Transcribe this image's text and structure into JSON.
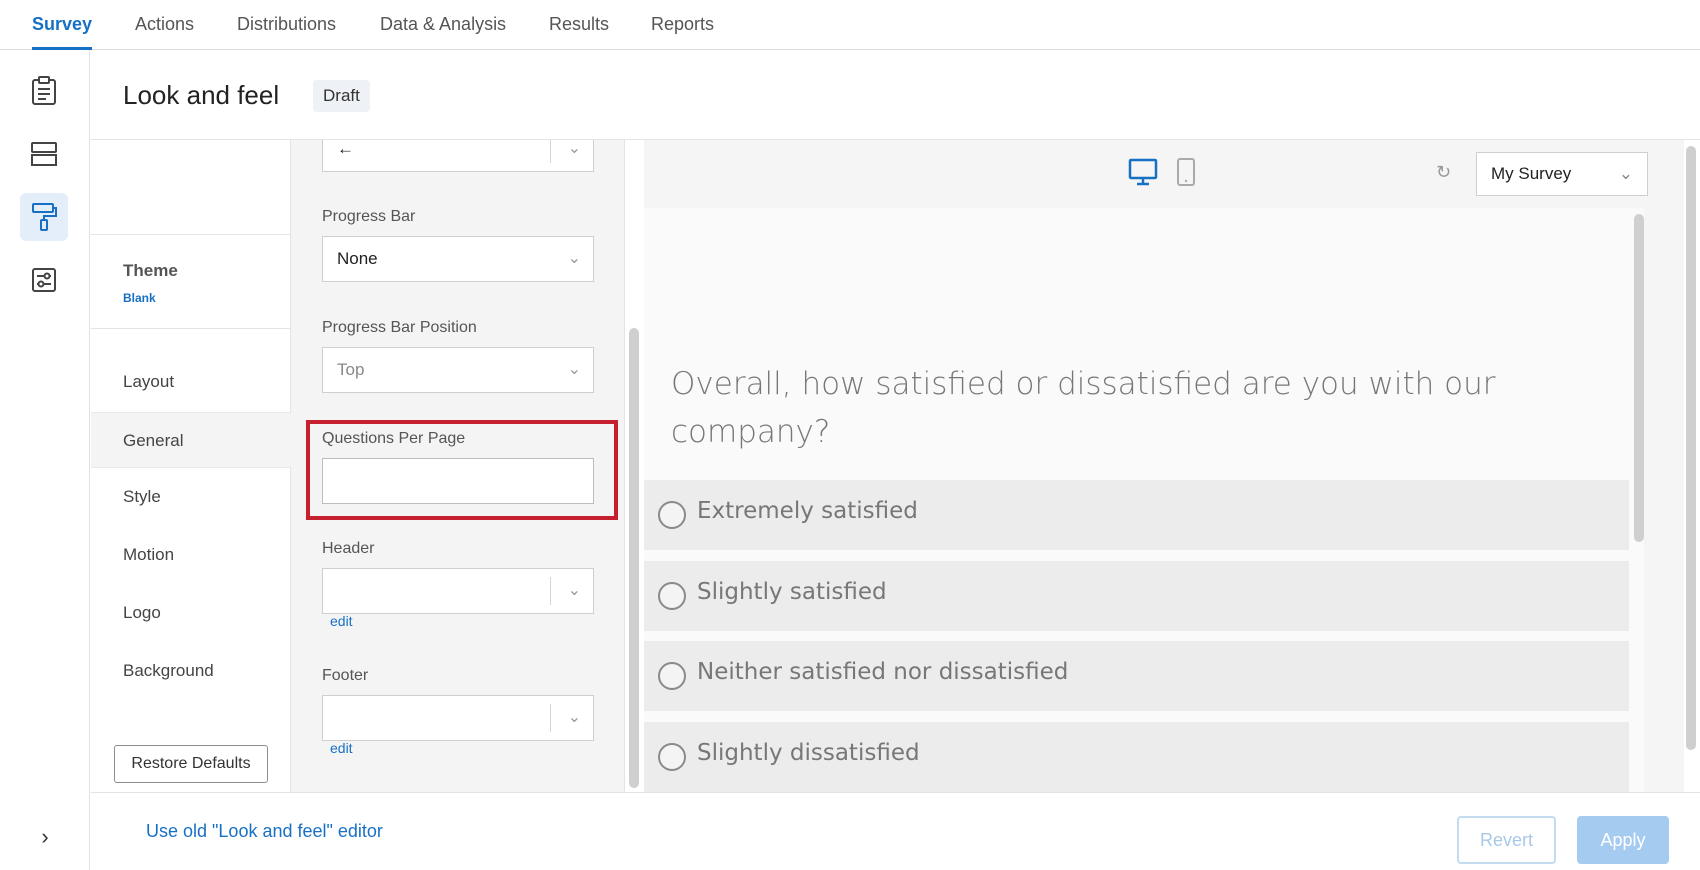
{
  "topnav": {
    "tabs": [
      {
        "label": "Survey",
        "active": true
      },
      {
        "label": "Actions"
      },
      {
        "label": "Distributions"
      },
      {
        "label": "Data & Analysis"
      },
      {
        "label": "Results"
      },
      {
        "label": "Reports"
      }
    ]
  },
  "rail": {
    "icons": [
      "clipboard-icon",
      "survey-flow-icon",
      "paint-roller-icon",
      "survey-options-icon"
    ],
    "active": "paint-roller-icon",
    "expand_glyph": "›"
  },
  "header": {
    "title": "Look and feel",
    "badge": "Draft"
  },
  "settings_nav": {
    "theme_label": "Theme",
    "theme_value": "Blank",
    "items": [
      {
        "label": "Layout"
      },
      {
        "label": "General",
        "active": true
      },
      {
        "label": "Style"
      },
      {
        "label": "Motion"
      },
      {
        "label": "Logo"
      },
      {
        "label": "Background"
      }
    ],
    "restore_label": "Restore Defaults"
  },
  "options": {
    "next_button_value": "←",
    "progress_bar_label": "Progress Bar",
    "progress_bar_value": "None",
    "progress_bar_position_label": "Progress Bar Position",
    "progress_bar_position_value": "Top",
    "questions_per_page_label": "Questions Per Page",
    "questions_per_page_value": "",
    "header_label": "Header",
    "header_edit": "edit",
    "footer_label": "Footer",
    "footer_edit": "edit"
  },
  "preview": {
    "survey_selector": "My Survey",
    "question": "Overall, how satisfied or dissatisfied are you with our company?",
    "choices": [
      "Extremely satisfied",
      "Slightly satisfied",
      "Neither satisfied nor dissatisfied",
      "Slightly dissatisfied"
    ]
  },
  "footer": {
    "old_editor_link": "Use old \"Look and feel\" editor",
    "revert_label": "Revert",
    "apply_label": "Apply"
  },
  "colors": {
    "accent": "#1770c4",
    "highlight": "#c4202e",
    "apply_disabled": "#a6cbf0"
  }
}
